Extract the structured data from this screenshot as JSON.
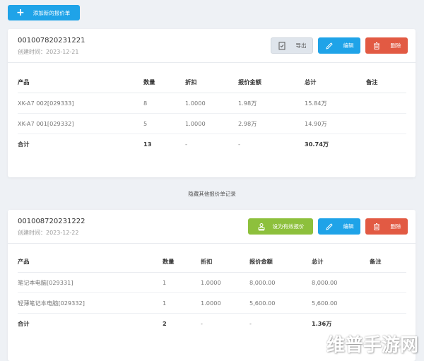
{
  "toolbar": {
    "add_label": "添加新的报价单"
  },
  "quotes": [
    {
      "id": "001007820231221",
      "date_label": "创建时间：2023-12-21",
      "buttons": {
        "export": "导出",
        "edit": "编辑",
        "delete": "删除"
      },
      "columns": [
        "产品",
        "数量",
        "折扣",
        "报价金额",
        "总计",
        "备注"
      ],
      "rows": [
        [
          "XK-A7 002[029333]",
          "8",
          "1.0000",
          "1.98万",
          "15.84万",
          ""
        ],
        [
          "XK-A7 001[029332]",
          "5",
          "1.0000",
          "2.98万",
          "14.90万",
          ""
        ]
      ],
      "total": [
        "合计",
        "13",
        "-",
        "-",
        "30.74万",
        ""
      ]
    },
    {
      "id": "001008720231222",
      "date_label": "创建时间：2023-12-22",
      "buttons": {
        "valid": "设为有效报价",
        "edit": "编辑",
        "delete": "删除"
      },
      "columns": [
        "产品",
        "数量",
        "折扣",
        "报价金额",
        "总计",
        "备注"
      ],
      "rows": [
        [
          "笔记本电脑[029331]",
          "1",
          "1.0000",
          "8,000.00",
          "8,000.00",
          ""
        ],
        [
          "轻薄笔记本电脑[029332]",
          "1",
          "1.0000",
          "5,600.00",
          "5,600.00",
          ""
        ]
      ],
      "total": [
        "合计",
        "2",
        "-",
        "-",
        "1.36万",
        ""
      ]
    }
  ],
  "toggle_label": "隐藏其他报价单记录",
  "watermark": "维普手游网"
}
